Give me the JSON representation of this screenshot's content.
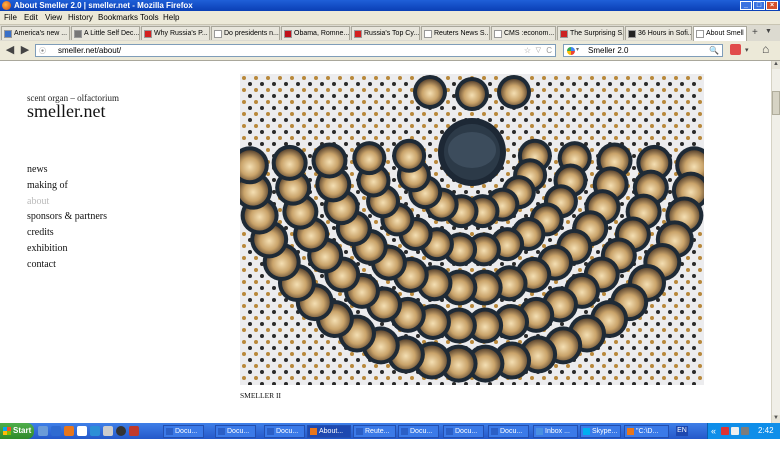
{
  "window": {
    "title": "About Smeller 2.0 | smeller.net - Mozilla Firefox",
    "min": "_",
    "max": "□",
    "close": "×"
  },
  "menu": [
    "File",
    "Edit",
    "View",
    "History",
    "Bookmarks",
    "Tools",
    "Help"
  ],
  "tabs": [
    {
      "label": "America's new ...",
      "fav_color": "#3a70c8"
    },
    {
      "label": "A Little Self Dec...",
      "fav_color": "#777777"
    },
    {
      "label": "Why Russia's P...",
      "fav_color": "#d42020"
    },
    {
      "label": "Do presidents n...",
      "fav_color": "#ffffff"
    },
    {
      "label": "Obama, Romne...",
      "fav_color": "#c0101a"
    },
    {
      "label": "Russia's Top Cy...",
      "fav_color": "#d42020"
    },
    {
      "label": "Reuters News S...",
      "fav_color": "#ffffff"
    },
    {
      "label": "CMS :econom...",
      "fav_color": "#ffffff"
    },
    {
      "label": "The Surprising S...",
      "fav_color": "#cc2222"
    },
    {
      "label": "36 Hours in Sofi...",
      "fav_color": "#222222"
    },
    {
      "label": "About Smell",
      "fav_color": "#ffffff",
      "active": true
    }
  ],
  "nav": {
    "back": "◀",
    "forward": "▶",
    "url": "smeller.net/about/",
    "star": "☆",
    "dropdown": "▽",
    "reload": "C",
    "search_text": "Smeller 2.0",
    "search_glyph": "🔍",
    "home": "⌂"
  },
  "page": {
    "tagline": "scent organ – olfactorium",
    "sitename": "smeller.net",
    "nav_items": [
      {
        "label": "news"
      },
      {
        "label": "making of"
      },
      {
        "label": "about",
        "current": true
      },
      {
        "label": "sponsors & partners"
      },
      {
        "label": "credits"
      },
      {
        "label": "exhibition"
      },
      {
        "label": "contact"
      }
    ],
    "caption": "SMELLER II"
  },
  "taskbar": {
    "start": "Start",
    "buttons": [
      {
        "label": "Docu...",
        "icon_color": "#2b5fc6"
      },
      {
        "label": "Docu...",
        "icon_color": "#2b5fc6"
      },
      {
        "label": "Docu...",
        "icon_color": "#2b5fc6"
      },
      {
        "label": "About...",
        "icon_color": "#e8761b",
        "active": true
      },
      {
        "label": "Reute...",
        "icon_color": "#2b5fc6"
      },
      {
        "label": "Docu...",
        "icon_color": "#2b5fc6"
      },
      {
        "label": "Docu...",
        "icon_color": "#2b5fc6"
      },
      {
        "label": "Docu...",
        "icon_color": "#2b5fc6"
      },
      {
        "label": "Inbox ...",
        "icon_color": "#4a90e2"
      },
      {
        "label": "Skype...",
        "icon_color": "#00aff0"
      },
      {
        "label": "\"C:\\D...",
        "icon_color": "#e8761b"
      }
    ],
    "lang": "EN",
    "tray_chevron": "«",
    "clock": "2:42 PM"
  }
}
